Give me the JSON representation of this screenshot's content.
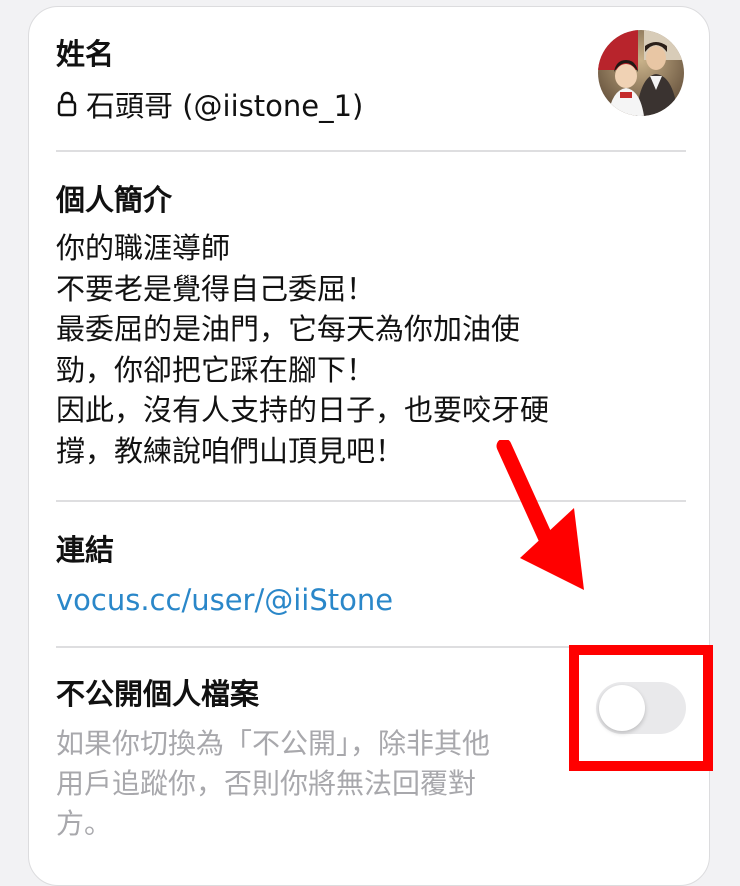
{
  "profile": {
    "name_label": "姓名",
    "display_name": "石頭哥 (@iistone_1)",
    "avatar_icon": "avatar-photo"
  },
  "bio": {
    "label": "個人簡介",
    "lines": [
      "你的職涯導師",
      "不要老是覺得自己委屈！",
      "最委屈的是油門，它每天為你加油使",
      "勁，你卻把它踩在腳下！",
      "因此，沒有人支持的日子，也要咬牙硬",
      "撐，教練說咱們山頂見吧！"
    ]
  },
  "links": {
    "label": "連結",
    "url_text": "vocus.cc/user/@iiStone"
  },
  "private_profile": {
    "label": "不公開個人檔案",
    "description_lines": [
      "如果你切換為「不公開」，除非其他",
      "用戶追蹤你，否則你將無法回覆對",
      "方。"
    ],
    "toggle_on": false
  },
  "colors": {
    "link": "#2a87c9",
    "annotation": "#ff0000",
    "toggle_off_track": "#e9e9eb",
    "muted_text": "#a8a8ac"
  }
}
